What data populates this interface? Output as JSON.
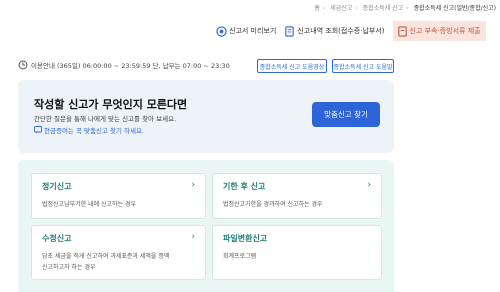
{
  "breadcrumb": [
    "홈",
    "세금신고",
    "종합소득세 신고",
    "종합소득세 신고(일반/종합/신고)"
  ],
  "top_actions": [
    {
      "label": "신고서 미리보기",
      "icon": "preview-icon"
    },
    {
      "label": "신고내역 조회(접수증·납부서)",
      "icon": "document-icon"
    },
    {
      "label": "신고 부속·증빙서류 제출",
      "icon": "attachment-icon"
    }
  ],
  "info": {
    "text": "이용안내 (365일) 06:00:00 ~ 23:59:59 단, 납부는 07:00 ~ 23:30",
    "buttons": [
      "종합소득세 신고 도움영상",
      "종합소득세 신고 도움말"
    ]
  },
  "banner": {
    "title": "작성할 신고가 무엇인지 모른다면",
    "desc": "간단한 질문을 통해 나에게 맞는 신고를 찾아 보세요.",
    "hint": "현금증여는 꼭 맞춤신고 찾기 하세요.",
    "button": "맞춤신고 찾기"
  },
  "cards": [
    {
      "title": "정기신고",
      "desc": [
        "법정신고납부기한 내에 신고하는 경우"
      ]
    },
    {
      "title": "기한 후 신고",
      "desc": [
        "법정신고기한을 경과하여 신고하는 경우"
      ]
    },
    {
      "title": "수정신고",
      "desc": [
        "당초 세금을 적게 신고하여 과세표준과 세액을 증액",
        "신고하고자 하는 경우"
      ]
    },
    {
      "title": "파일변환신고",
      "desc": [
        "회계프로그램"
      ]
    }
  ],
  "colors": {
    "primary": "#2d64d8",
    "teal": "#1f7d75",
    "highlight_bg": "#fbe3de"
  }
}
